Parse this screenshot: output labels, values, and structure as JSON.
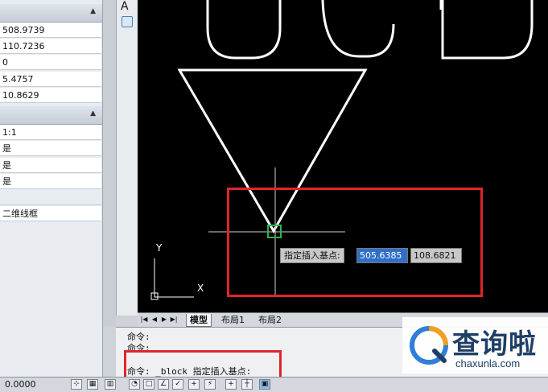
{
  "properties_panel": {
    "section1_values": [
      "508.9739",
      "110.7236",
      "0",
      "5.4757",
      "10.8629"
    ],
    "section2_values": [
      "1:1",
      "是",
      "是",
      "是",
      "",
      "二维线框"
    ]
  },
  "toolbar_left": {
    "text_tool": "A"
  },
  "layout_tabs": {
    "tabs": [
      "模型",
      "布局1",
      "布局2"
    ],
    "active": "模型"
  },
  "command": {
    "history": [
      "命令:",
      "命令:"
    ],
    "prompt": "命令:  _block 指定插入基点:"
  },
  "dynamic_input": {
    "label": "指定插入基点:",
    "x_value": "505.6385",
    "y_value": "108.6821"
  },
  "ucs": {
    "x_label": "X",
    "y_label": "Y"
  },
  "status_bar": {
    "coordinates": "0.0000"
  },
  "watermark": {
    "title": "查询啦",
    "url": "chaxunla.com"
  },
  "colors": {
    "highlight_red": "#e0242b",
    "selected_blue": "#2f6fc8",
    "osnap_green": "#2fb44a"
  }
}
